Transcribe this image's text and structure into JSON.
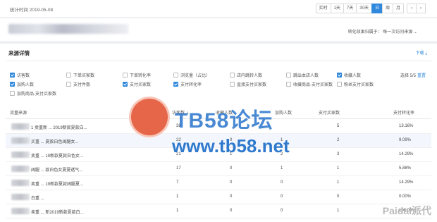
{
  "topbar": {
    "stat_time": "统计时间 2019-05-08",
    "buttons": [
      "实时",
      "1天",
      "7天",
      "30天",
      "日",
      "周",
      "月",
      "‹",
      "›"
    ],
    "active_index": 4
  },
  "shop": {
    "attr_label": "转化效果归属于：  每一次访问来源 ⌄"
  },
  "panel": {
    "title": "来源详情",
    "download": "下载 ⤓",
    "selected": "选择 5/5",
    "reset": "重置"
  },
  "checks": [
    {
      "label": "访客数",
      "checked": true
    },
    {
      "label": "下单买家数",
      "checked": false
    },
    {
      "label": "下单转化率",
      "checked": false
    },
    {
      "label": "浏览量（占比）",
      "checked": false
    },
    {
      "label": "店内跳转人数",
      "checked": false
    },
    {
      "label": "跳出本店人数",
      "checked": false
    },
    {
      "label": "收藏人数",
      "checked": true
    },
    {
      "label": "加购人数",
      "checked": true
    },
    {
      "label": "支付件数",
      "checked": false
    },
    {
      "label": "支付买家数",
      "checked": true
    },
    {
      "label": "支付转化率",
      "checked": true
    },
    {
      "label": "直接支付买家数",
      "checked": false
    },
    {
      "label": "收藏商品-支付买家数",
      "checked": false
    },
    {
      "label": "粉丝支付买家数",
      "checked": false
    },
    {
      "label": "加购商品-支付买家数",
      "checked": false
    }
  ],
  "table": {
    "headers": [
      "流量来源",
      "访客数 ⇣",
      "收藏人数",
      "加购人数",
      "支付买家数",
      "支付转化率"
    ],
    "rows": [
      {
        "name": "1 卖重新 ... 2019新款夏款白...",
        "visitors": "38",
        "fav": "",
        "cart": "",
        "buyers": "5",
        "rate": "13.16%"
      },
      {
        "name": "买重 ... 夏款白色阔腿女...",
        "visitors": "22",
        "fav": "0",
        "cart": "1",
        "buyers": "2",
        "rate": "9.09%"
      },
      {
        "name": "卖重 ... 19新款夏款白色女...",
        "visitors": "21",
        "fav": "1",
        "cart": "2",
        "buyers": "3",
        "rate": "14.29%"
      },
      {
        "name": "阔腿 ... 款白色女夏夏透气...",
        "visitors": "17",
        "fav": "0",
        "cart": "1",
        "buyers": "1",
        "rate": "5.88%"
      },
      {
        "name": "卖重 ... 19新款夏款阔腿夏...",
        "visitors": "7",
        "fav": "0",
        "cart": "0",
        "buyers": "1",
        "rate": "14.29%"
      },
      {
        "name": "白重 ...",
        "visitors": "1",
        "fav": "0",
        "cart": "0",
        "buyers": "0",
        "rate": "0.00%"
      },
      {
        "name": "卖重 ... 新2019新款夏款白...",
        "visitors": "1",
        "fav": "0",
        "cart": "0",
        "buyers": "1",
        "rate": "100.00%"
      }
    ]
  },
  "watermark": {
    "brand": "TB58论坛",
    "url": "www.tb58.net",
    "corner": "Paidai派代"
  }
}
